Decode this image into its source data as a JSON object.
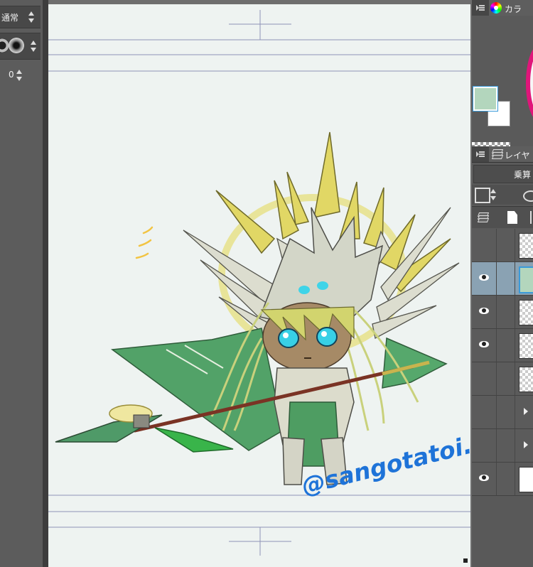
{
  "tool_property": {
    "blend_mode_label": "通常",
    "numeric_value": "0"
  },
  "color_panel": {
    "tab_label": "カラ",
    "icon": "color-wheel-icon",
    "foreground_color": "#b3d6bd",
    "background_color": "#ffffff"
  },
  "layer_panel": {
    "tab_label": "レイヤ",
    "icon": "layers-icon",
    "blend_mode": "乗算",
    "layers": [
      {
        "visible": false,
        "thumb": "transparent",
        "edit": false
      },
      {
        "visible": true,
        "thumb": "green",
        "edit": true,
        "selected": true
      },
      {
        "visible": true,
        "thumb": "transparent",
        "edit": false
      },
      {
        "visible": true,
        "thumb": "transparent",
        "edit": false
      },
      {
        "visible": false,
        "thumb": "transparent",
        "edit": false
      },
      {
        "visible": false,
        "thumb": "folder",
        "edit": false
      },
      {
        "visible": false,
        "thumb": "folder",
        "edit": false
      },
      {
        "visible": true,
        "thumb": "white",
        "edit": false
      }
    ]
  },
  "canvas": {
    "paper_color": "#eef3f1",
    "signature_text": "@sangotatoi.bot",
    "signature_color": "#1e73d8"
  }
}
